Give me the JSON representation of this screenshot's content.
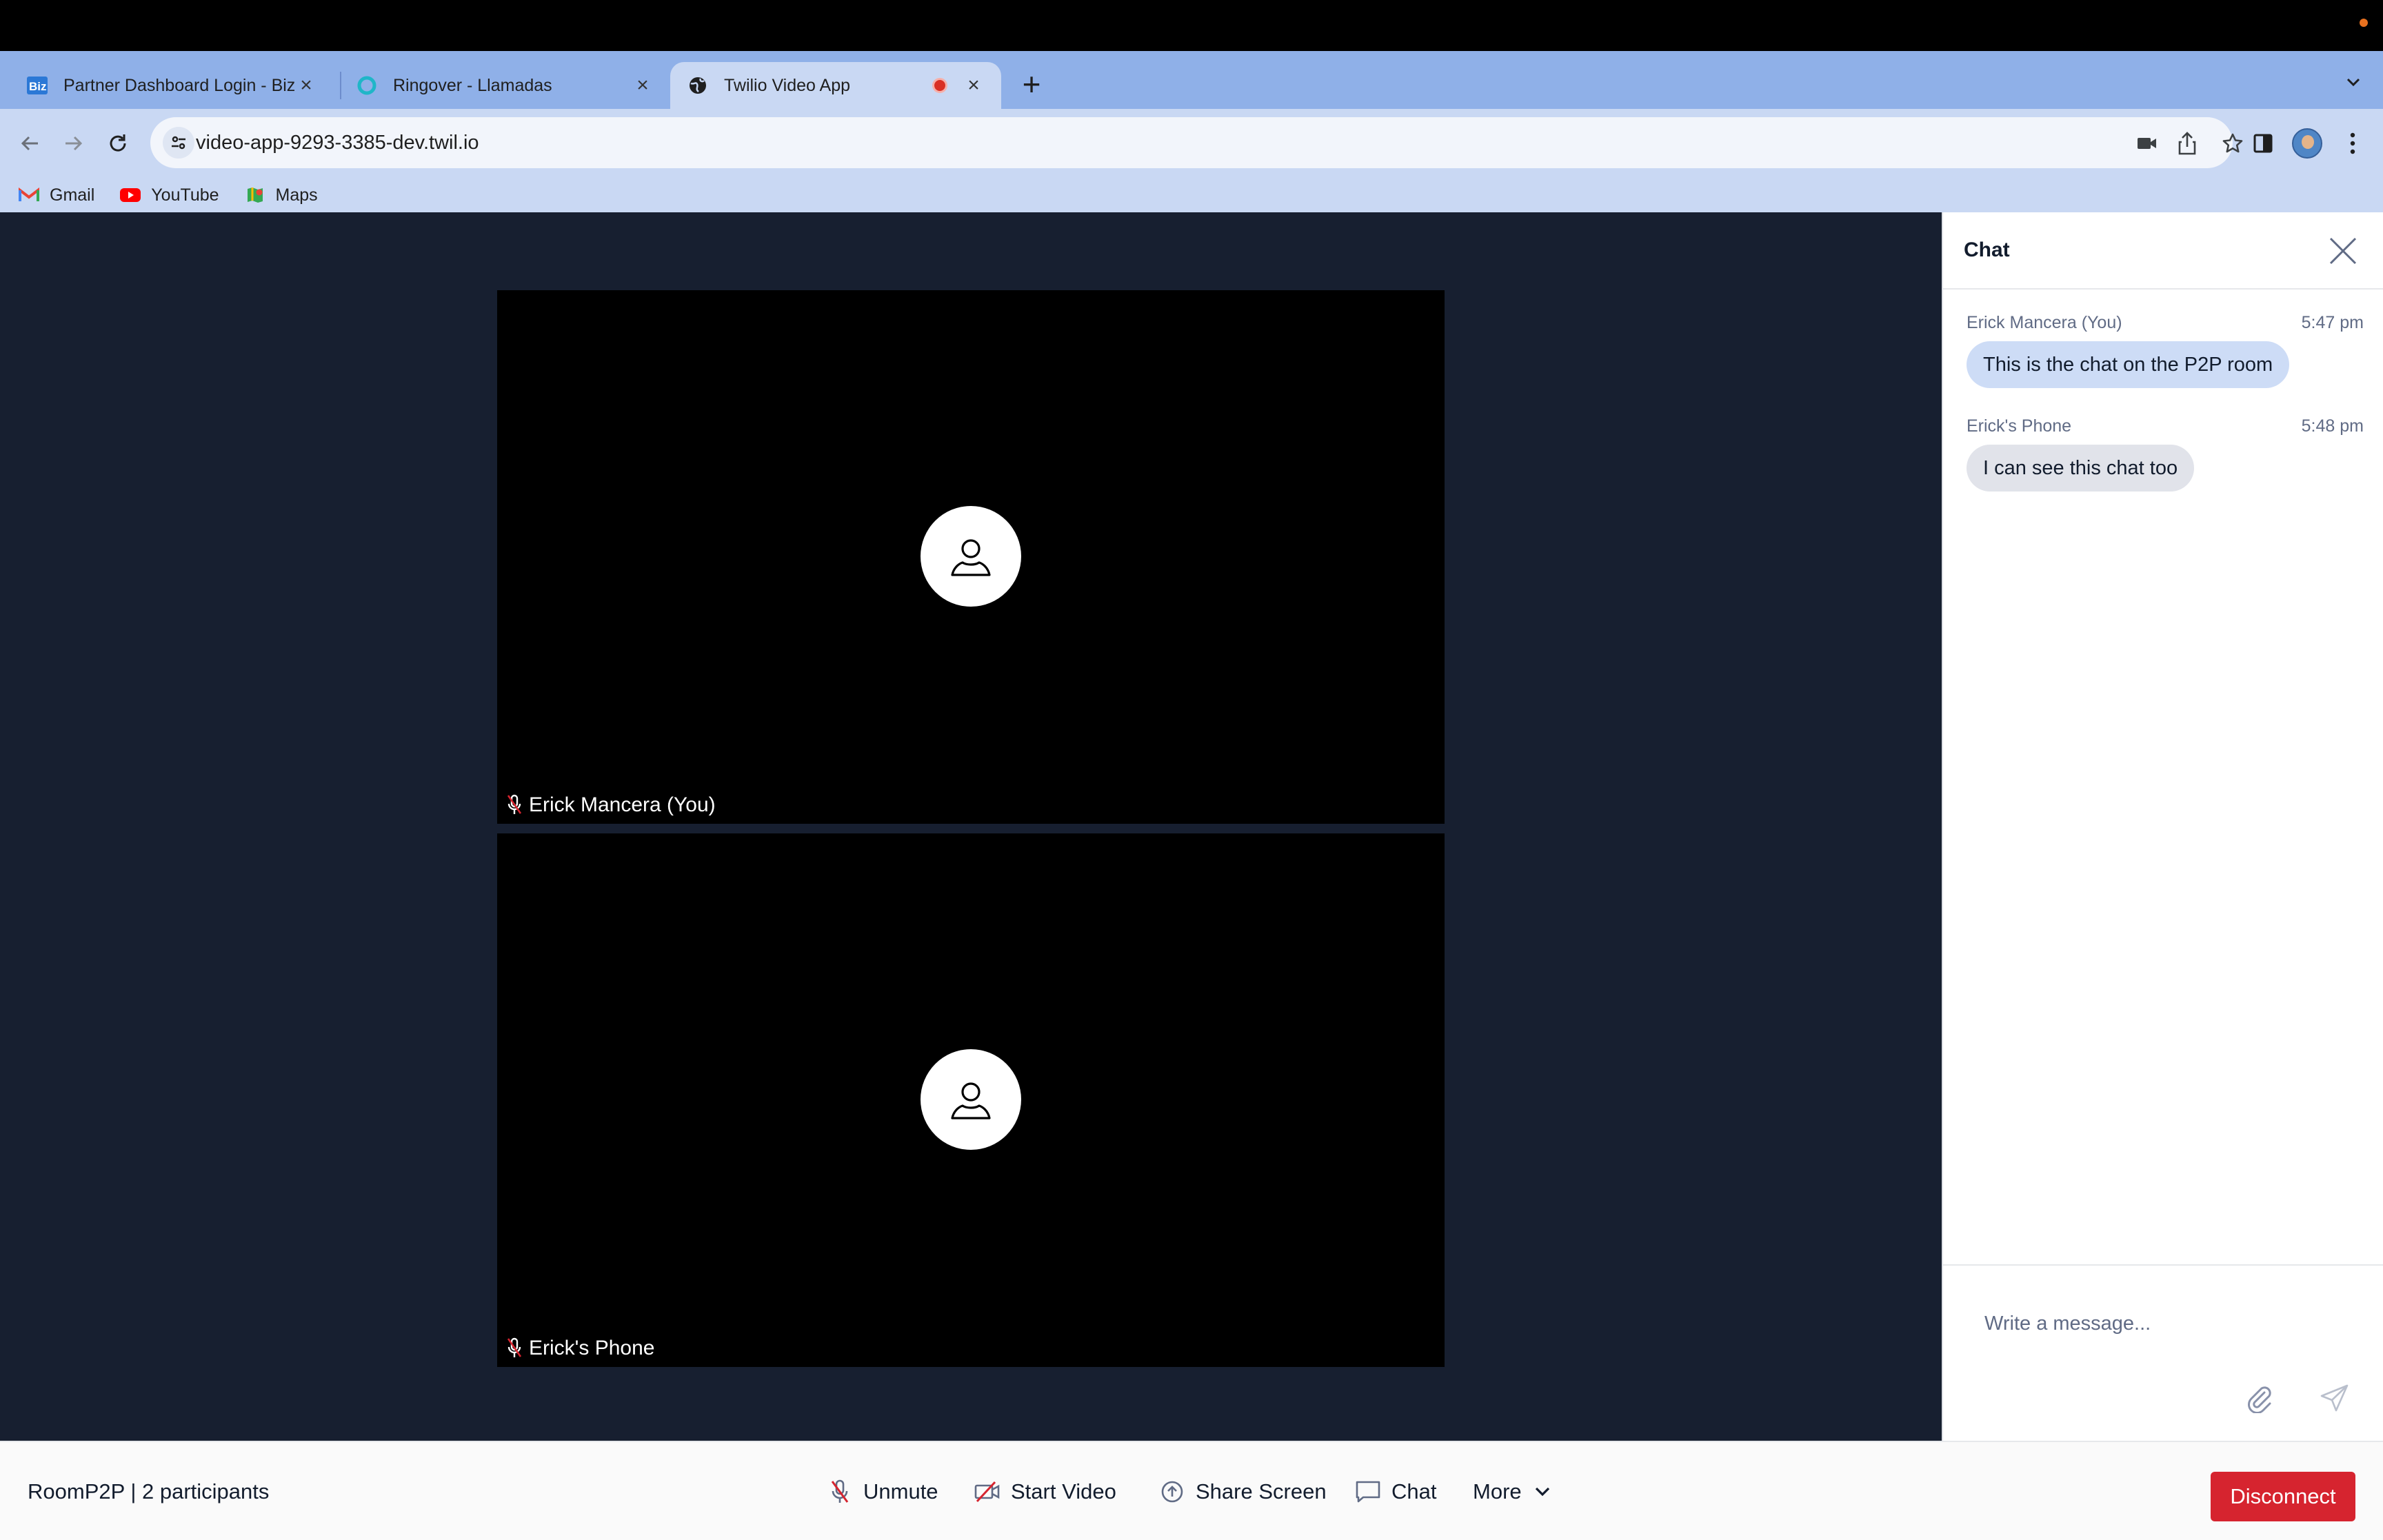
{
  "browser": {
    "tabs": [
      {
        "title": "Partner Dashboard Login - Biz",
        "favicon": "biz-logo-icon"
      },
      {
        "title": "Ringover - Llamadas",
        "favicon": "ringover-icon"
      },
      {
        "title": "Twilio Video App",
        "favicon": "globe-icon",
        "active": true,
        "recording": true
      }
    ],
    "url": "video-app-9293-3385-dev.twil.io",
    "bookmarks": [
      {
        "label": "Gmail",
        "icon": "gmail-icon"
      },
      {
        "label": "YouTube",
        "icon": "youtube-icon"
      },
      {
        "label": "Maps",
        "icon": "maps-icon"
      }
    ]
  },
  "participants": [
    {
      "name": "Erick Mancera (You)",
      "muted": true
    },
    {
      "name": "Erick's Phone",
      "muted": true
    }
  ],
  "chat": {
    "title": "Chat",
    "messages": [
      {
        "author": "Erick Mancera (You)",
        "time": "5:47 pm",
        "text": "This is the chat on the P2P room",
        "self": true
      },
      {
        "author": "Erick's Phone",
        "time": "5:48 pm",
        "text": "I can see this chat too",
        "self": false
      }
    ],
    "input_placeholder": "Write a message..."
  },
  "menu_bar": {
    "room_info": "RoomP2P | 2 participants",
    "unmute_label": "Unmute",
    "start_video_label": "Start Video",
    "share_screen_label": "Share Screen",
    "chat_label": "Chat",
    "more_label": "More",
    "disconnect_label": "Disconnect"
  },
  "colors": {
    "stage_bg": "#171f30",
    "disconnect": "#d6242f",
    "muted_icon": "#d6242f",
    "self_bubble": "#cddcf6",
    "other_bubble": "#e1e3ea",
    "tab_strip": "#8fb0e8"
  }
}
